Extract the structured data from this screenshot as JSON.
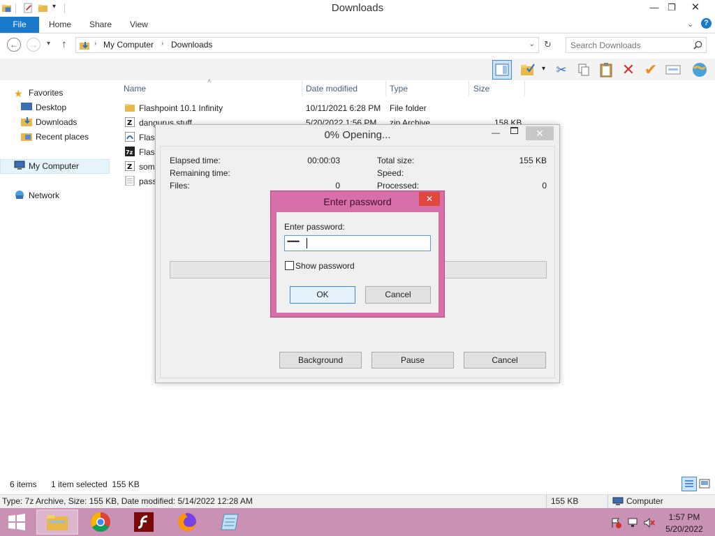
{
  "window": {
    "title": "Downloads"
  },
  "ribbon": {
    "tabs": [
      "File",
      "Home",
      "Share",
      "View"
    ]
  },
  "address": {
    "crumbs": [
      "My Computer",
      "Downloads"
    ],
    "search_placeholder": "Search Downloads"
  },
  "nav": {
    "favorites": "Favorites",
    "items": [
      "Desktop",
      "Downloads",
      "Recent places"
    ],
    "my_computer": "My Computer",
    "network": "Network"
  },
  "columns": {
    "name": "Name",
    "date": "Date modified",
    "type": "Type",
    "size": "Size"
  },
  "files": [
    {
      "name": "Flashpoint 10.1 Infinity",
      "date": "10/11/2021 6:28 PM",
      "type": "File folder",
      "size": ""
    },
    {
      "name": "dangurus stuff",
      "date": "5/20/2022 1:56 PM",
      "type": "zip Archive",
      "size": "158 KB"
    },
    {
      "name": "Flash",
      "date": "",
      "type": "",
      "size": ""
    },
    {
      "name": "Flash",
      "date": "",
      "type": "",
      "size": ""
    },
    {
      "name": "som",
      "date": "",
      "type": "",
      "size": ""
    },
    {
      "name": "pass",
      "date": "",
      "type": "",
      "size": ""
    }
  ],
  "progress": {
    "title": "0% Opening...",
    "elapsed_label": "Elapsed time:",
    "elapsed_value": "00:00:03",
    "remaining_label": "Remaining time:",
    "files_label": "Files:",
    "files_value": "0",
    "total_label": "Total size:",
    "total_value": "155 KB",
    "speed_label": "Speed:",
    "processed_label": "Processed:",
    "processed_value": "0",
    "percent": 0,
    "buttons": {
      "background": "Background",
      "pause": "Pause",
      "cancel": "Cancel"
    }
  },
  "password_dialog": {
    "title": "Enter password",
    "label": "Enter password:",
    "value": "••••••••",
    "show_password": "Show password",
    "show_checked": false,
    "ok": "OK",
    "cancel": "Cancel"
  },
  "status": {
    "items": "6 items",
    "selected": "1 item selected  155 KB",
    "detail": "Type: 7z Archive, Size: 155 KB, Date modified: 5/14/2022 12:28 AM",
    "size": "155 KB",
    "location": "Computer"
  },
  "clock": {
    "time": "1:57 PM",
    "date": "5/20/2022"
  },
  "colors": {
    "accent": "#1979ca",
    "taskbar": "#c992b4",
    "dialog_frame": "#d96fa8"
  }
}
